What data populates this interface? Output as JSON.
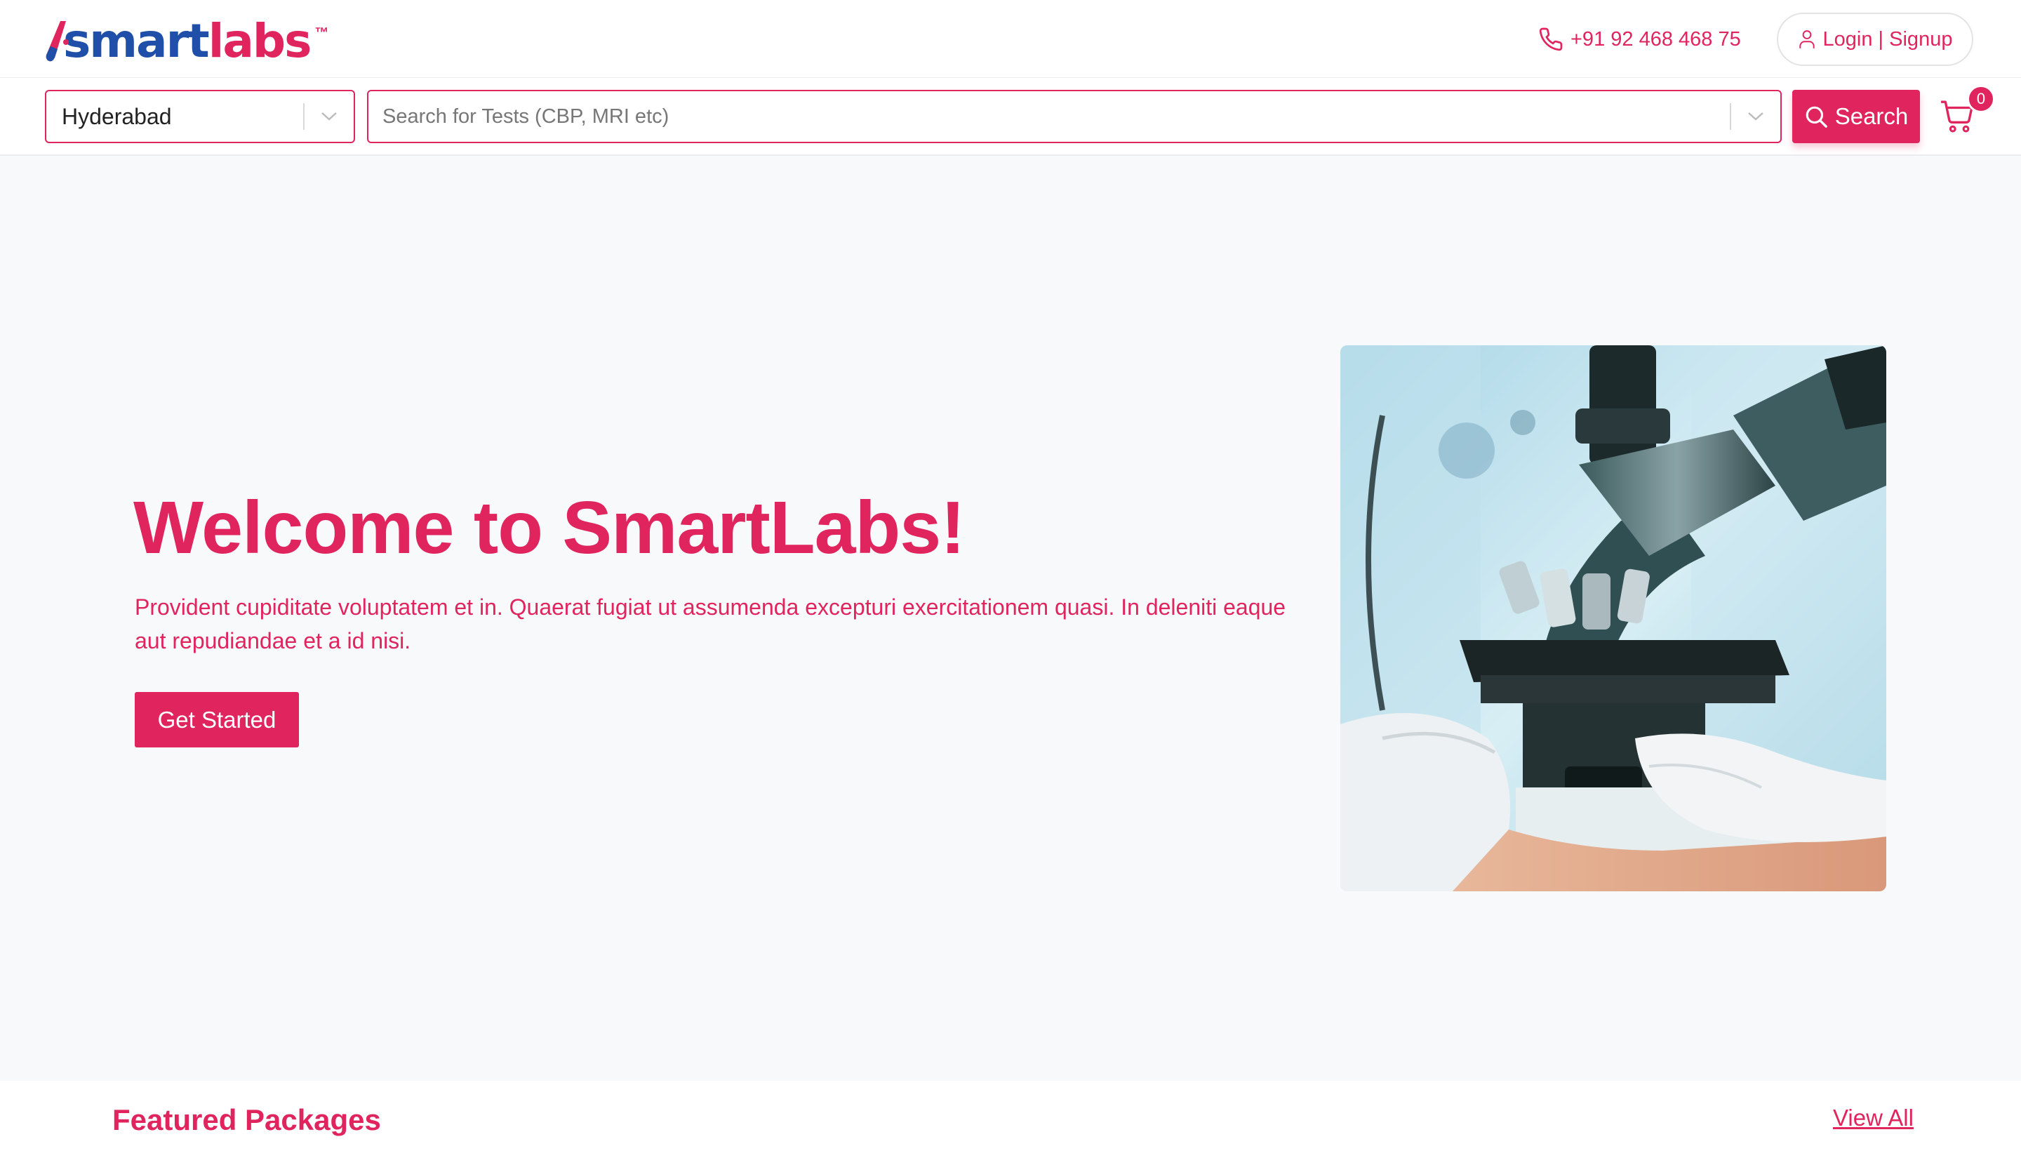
{
  "brand": {
    "logo_part1": "smart",
    "logo_part2": "labs",
    "logo_tm": "™",
    "primary_color": "#e0245e",
    "secondary_color": "#1f4fa8"
  },
  "header": {
    "phone_icon": "phone-icon",
    "phone": "+91 92 468 468 75",
    "login_icon": "user-icon",
    "login_label": "Login | Signup"
  },
  "search": {
    "city": "Hyderabad",
    "placeholder": "Search for Tests (CBP, MRI etc)",
    "button_label": "Search",
    "cart_count": "0"
  },
  "hero": {
    "title": "Welcome to SmartLabs!",
    "text": "Provident cupiditate voluptatem et in. Quaerat fugiat ut assumenda excepturi exercitationem quasi. In deleniti eaque aut repudiandae et a id nisi.",
    "cta_label": "Get Started",
    "image_subject": "microscope-photo"
  },
  "featured": {
    "title": "Featured Packages",
    "view_all": "View All"
  }
}
